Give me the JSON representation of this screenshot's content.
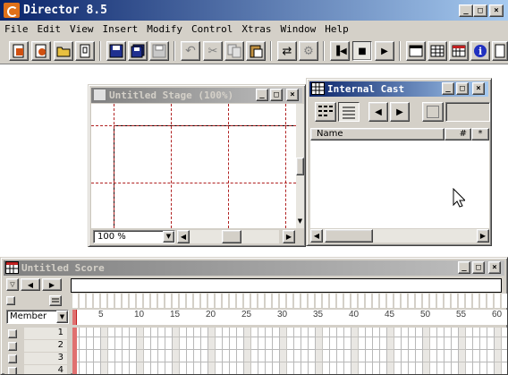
{
  "app": {
    "title": "Director 8.5"
  },
  "menus": [
    "File",
    "Edit",
    "View",
    "Insert",
    "Modify",
    "Control",
    "Xtras",
    "Window",
    "Help"
  ],
  "stage": {
    "title": "Untitled Stage (100%)",
    "zoom": "100 %"
  },
  "cast": {
    "title": "Internal Cast",
    "col_name": "Name",
    "col_num": "#",
    "col_star": "*"
  },
  "score": {
    "title": "Untitled Score",
    "channel_select": "Member",
    "channels": [
      "1",
      "2",
      "3",
      "4"
    ],
    "frame_ticks": [
      "5",
      "10",
      "15",
      "20",
      "25",
      "30",
      "35",
      "40",
      "45",
      "50",
      "55",
      "60"
    ]
  }
}
